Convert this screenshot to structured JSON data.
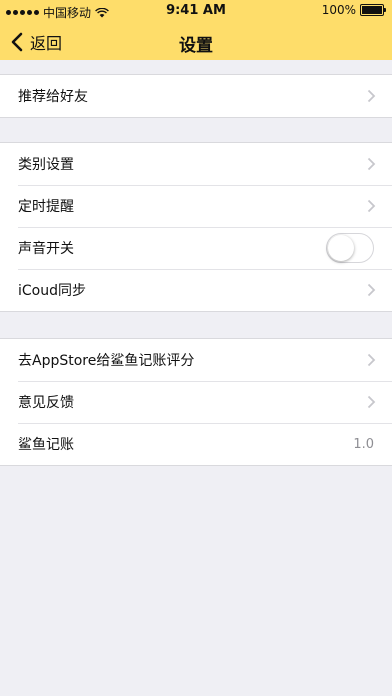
{
  "status_bar": {
    "carrier": "中国移动",
    "time": "9:41 AM",
    "battery": "100%"
  },
  "nav": {
    "back_label": "返回",
    "title": "设置"
  },
  "colors": {
    "nav_bg": "#fedd6a",
    "page_bg": "#efeff4",
    "chevron": "#c7c7cc"
  },
  "groups": [
    {
      "items": [
        {
          "label": "推荐给好友",
          "accessory": "chevron"
        }
      ]
    },
    {
      "items": [
        {
          "label": "类别设置",
          "accessory": "chevron"
        },
        {
          "label": "定时提醒",
          "accessory": "chevron"
        },
        {
          "label": "声音开关",
          "accessory": "toggle",
          "toggle_on": false
        },
        {
          "label": "iCoud同步",
          "accessory": "chevron"
        }
      ]
    },
    {
      "items": [
        {
          "label": "去AppStore给鲨鱼记账评分",
          "accessory": "chevron"
        },
        {
          "label": "意见反馈",
          "accessory": "chevron"
        },
        {
          "label": "鲨鱼记账",
          "accessory": "value",
          "value": "1.0"
        }
      ]
    }
  ]
}
